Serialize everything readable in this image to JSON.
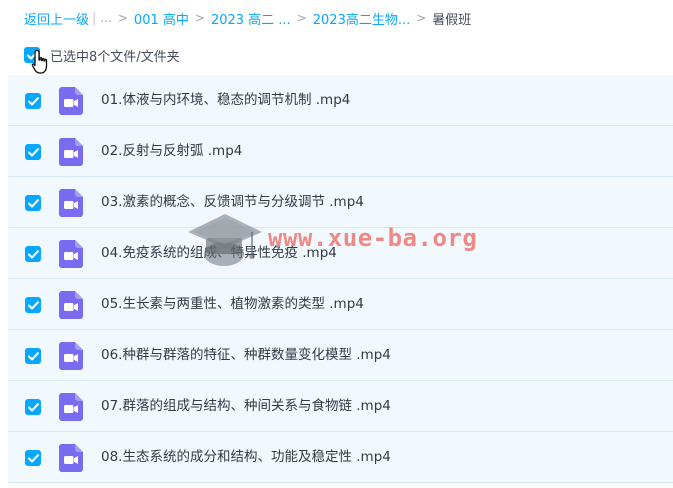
{
  "breadcrumb": {
    "back": "返回上一级",
    "ellipsis": "...",
    "items": [
      "001 高中",
      "2023 高二 ...",
      "2023高二生物..."
    ],
    "current": "暑假班"
  },
  "selection": {
    "summary": "已选中8个文件/文件夹"
  },
  "files": [
    {
      "name": "01.体液与内环境、稳态的调节机制 .mp4"
    },
    {
      "name": "02.反射与反射弧 .mp4"
    },
    {
      "name": "03.激素的概念、反馈调节与分级调节 .mp4"
    },
    {
      "name": "04.免疫系统的组成、特异性免疫 .mp4"
    },
    {
      "name": "05.生长素与两重性、植物激素的类型 .mp4"
    },
    {
      "name": "06.种群与群落的特征、种群数量变化模型 .mp4"
    },
    {
      "name": "07.群落的组成与结构、种间关系与食物链 .mp4"
    },
    {
      "name": "08.生态系统的成分和结构、功能及稳定性 .mp4"
    }
  ],
  "watermark": {
    "text": "www.xue-ba.org"
  },
  "colors": {
    "accent": "#06a7ff",
    "row_bg": "#f1f8fe",
    "video_icon": "#7a6cf0",
    "watermark": "#ec6054"
  },
  "icons": {
    "checkbox": "checkbox-checked-icon",
    "file": "video-file-icon",
    "cursor": "hand-cursor-icon"
  }
}
